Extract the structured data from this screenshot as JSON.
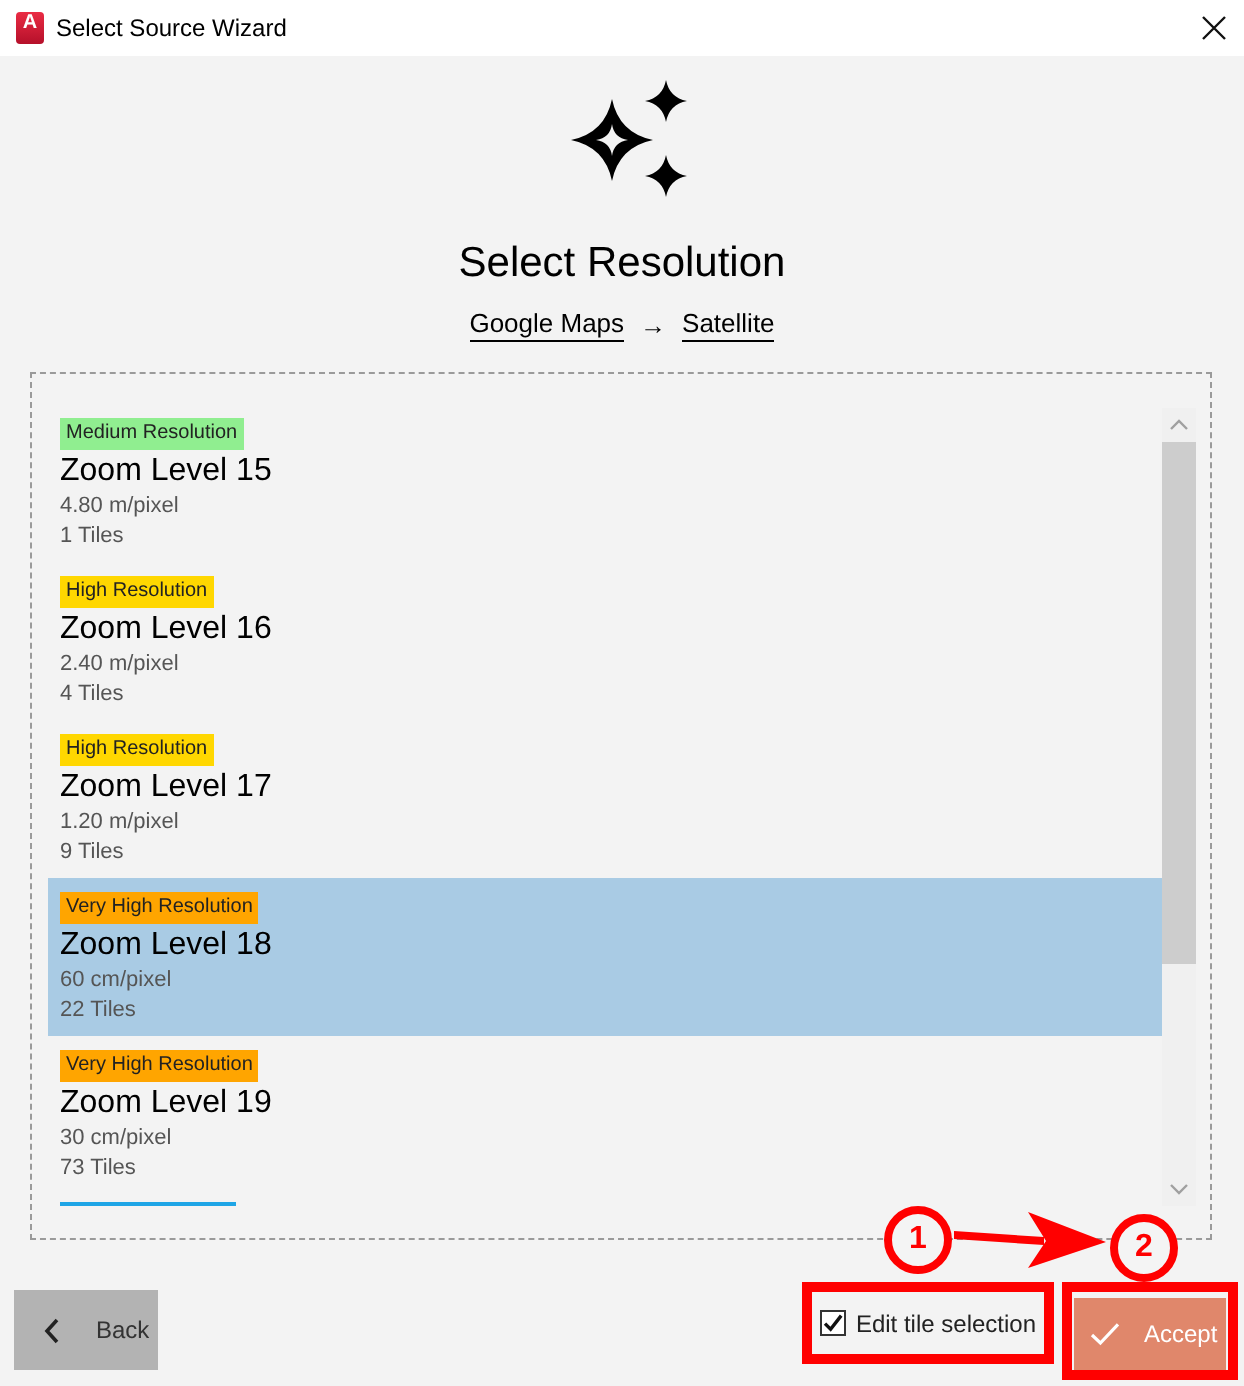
{
  "window": {
    "title": "Select Source Wizard",
    "app_icon_text": "A"
  },
  "header": {
    "title": "Select Resolution",
    "breadcrumb": [
      "Google Maps",
      "Satellite"
    ],
    "separator": "→"
  },
  "resolutions": [
    {
      "badge": "Medium Resolution",
      "color": "#90ee90",
      "name": "Zoom Level 15",
      "scale": "4.80 m/pixel",
      "tiles": "1 Tiles",
      "selected": false
    },
    {
      "badge": "High Resolution",
      "color": "#ffd700",
      "name": "Zoom Level 16",
      "scale": "2.40 m/pixel",
      "tiles": "4 Tiles",
      "selected": false
    },
    {
      "badge": "High Resolution",
      "color": "#ffd700",
      "name": "Zoom Level 17",
      "scale": "1.20 m/pixel",
      "tiles": "9 Tiles",
      "selected": false
    },
    {
      "badge": "Very High Resolution",
      "color": "#ffa500",
      "name": "Zoom Level 18",
      "scale": "60 cm/pixel",
      "tiles": "22 Tiles",
      "selected": true
    },
    {
      "badge": "Very High Resolution",
      "color": "#ffa500",
      "name": "Zoom Level 19",
      "scale": "30 cm/pixel",
      "tiles": "73 Tiles",
      "selected": false
    }
  ],
  "next_badge_edge": {
    "color": "#1ea5e6"
  },
  "footer": {
    "back_button": {
      "label": "Back"
    },
    "edit_tile_selection": {
      "label": "Edit tile selection",
      "checked": true
    },
    "accept_button": {
      "label": "Accept"
    }
  },
  "annotations": [
    {
      "label": "1"
    },
    {
      "label": "2"
    }
  ]
}
